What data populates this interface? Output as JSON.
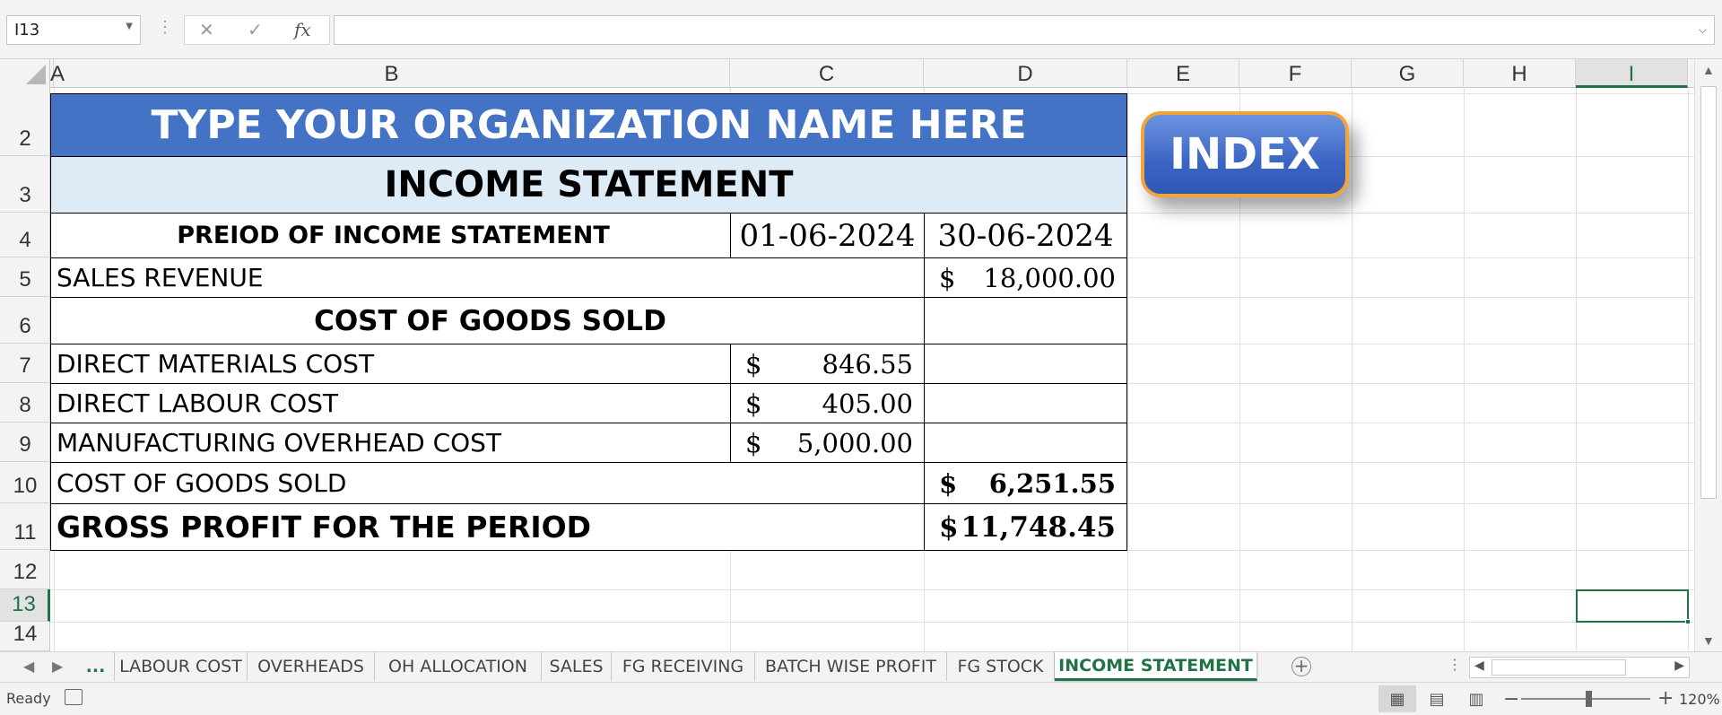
{
  "formula_bar": {
    "name_box": "I13",
    "cancel_glyph": "✕",
    "enter_glyph": "✓",
    "fx_label": "fx",
    "formula": ""
  },
  "columns": [
    "A",
    "B",
    "C",
    "D",
    "E",
    "F",
    "G",
    "H",
    "I"
  ],
  "rows": [
    "2",
    "3",
    "4",
    "5",
    "6",
    "7",
    "8",
    "9",
    "10",
    "11",
    "12",
    "13",
    "14"
  ],
  "sheet": {
    "org_name": "TYPE YOUR ORGANIZATION NAME HERE",
    "statement_title": "INCOME STATEMENT",
    "period_label": "PREIOD OF INCOME STATEMENT",
    "period_start": "01-06-2024",
    "period_end": "30-06-2024",
    "sales_revenue_label": "SALES REVENUE",
    "sales_revenue_currency": "$",
    "sales_revenue_amount": "18,000.00",
    "cogs_header": "COST OF GOODS SOLD",
    "dm_label": "DIRECT MATERIALS COST",
    "dm_currency": "$",
    "dm_amount": "846.55",
    "dl_label": "DIRECT LABOUR COST",
    "dl_currency": "$",
    "dl_amount": "405.00",
    "moh_label": "MANUFACTURING OVERHEAD COST",
    "moh_currency": "$",
    "moh_amount": "5,000.00",
    "cogs_label": "COST OF GOODS SOLD",
    "cogs_currency": "$",
    "cogs_amount": "6,251.55",
    "gp_label": "GROSS PROFIT FOR THE PERIOD",
    "gp_currency": "$",
    "gp_amount": "11,748.45"
  },
  "index_button": "INDEX",
  "tabs": {
    "more": "...",
    "items": [
      "LABOUR COST",
      "OVERHEADS",
      "OH ALLOCATION",
      "SALES",
      "FG RECEIVING",
      "BATCH WISE PROFIT",
      "FG STOCK",
      "INCOME STATEMENT"
    ],
    "active": "INCOME STATEMENT"
  },
  "status": {
    "ready": "Ready",
    "zoom": "120%"
  },
  "colors": {
    "accent": "#217346",
    "header_blue": "#4472c4",
    "title_fill": "#ddebf7",
    "button_border": "#f0a43a"
  }
}
